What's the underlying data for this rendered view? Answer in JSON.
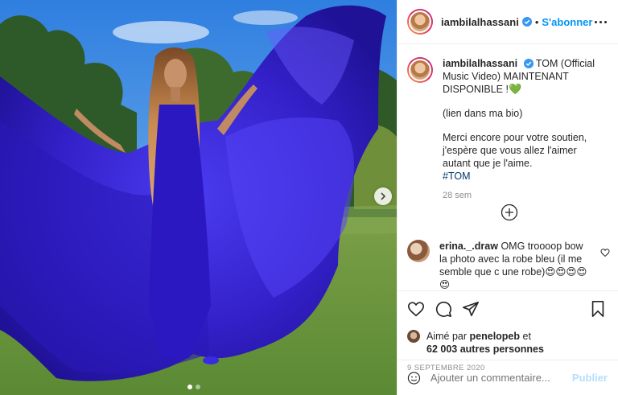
{
  "header": {
    "username": "iambilalhassani",
    "separator": "•",
    "follow_label": "S'abonner"
  },
  "caption": {
    "username": "iambilalhassani",
    "line1": "TOM (Official Music Video) MAINTENANT DISPONIBLE !",
    "line1_emoji": "💚",
    "line2": "(lien dans ma bio)",
    "line3": "Merci encore pour votre soutien, j'espère que vous allez l'aimer autant que je l'aime.",
    "hashtag": "#TOM",
    "time": "28 sem"
  },
  "comment": {
    "username": "erina._.draw",
    "text": "OMG troooop bow la photo avec la robe bleu (il me semble que c une robe)",
    "emojis": "😍😍😍😍😍"
  },
  "likes": {
    "prefix": "Aimé par",
    "user": "penelopeb",
    "connector": "et",
    "count": "62 003 autres personnes"
  },
  "date": "9 septembre 2020",
  "add_comment": {
    "placeholder": "Ajouter un commentaire...",
    "publish_label": "Publier"
  },
  "carousel": {
    "slides": 2,
    "active_slide": 1
  },
  "colors": {
    "accent": "#0095f6",
    "dress": "#3b2bd6",
    "sky": "#3c8ce0",
    "grass": "#6f9a3e"
  },
  "icons": [
    "verified-icon",
    "more-icon",
    "chevron-right-icon",
    "plus-circle-icon",
    "heart-icon",
    "comment-icon",
    "share-icon",
    "bookmark-icon",
    "smile-icon"
  ]
}
